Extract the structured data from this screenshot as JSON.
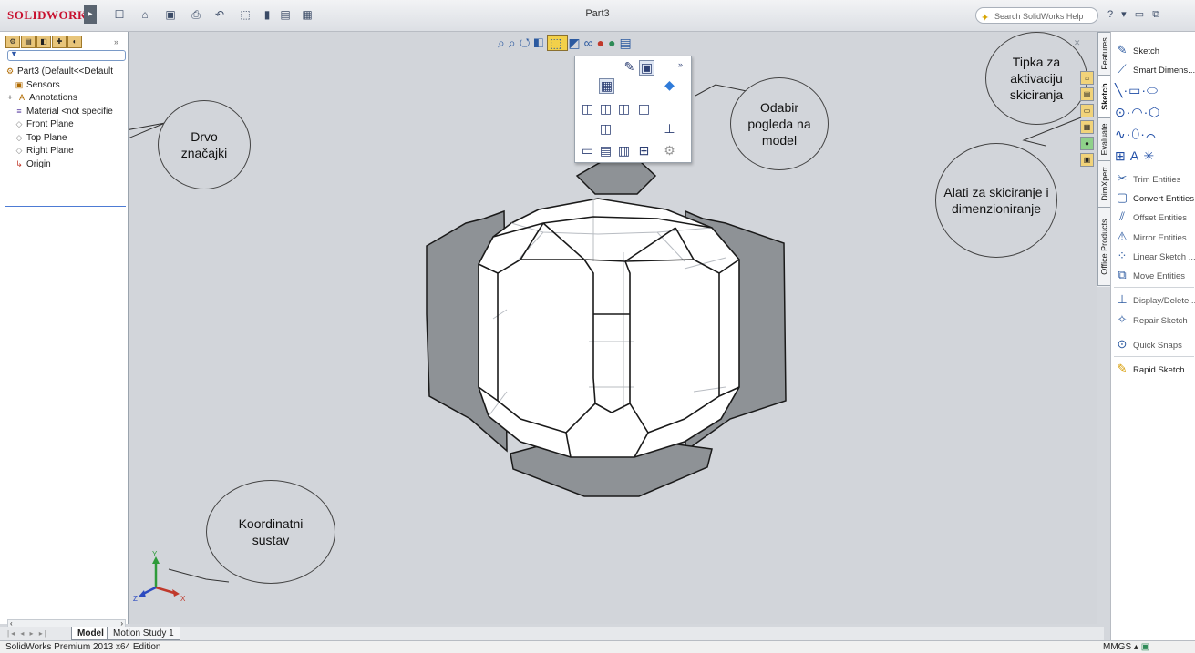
{
  "app": {
    "logo": "SOLIDWORKS",
    "document_title": "Part3",
    "help_search_placeholder": "Search SolidWorks Help",
    "window_controls": "? ▾ ▭ ⧉"
  },
  "feature_tree": {
    "root": "Part3  (Default<<Default",
    "items": [
      {
        "label": "Sensors",
        "icon": "sensor-icon"
      },
      {
        "label": "Annotations",
        "icon": "annotations-icon"
      },
      {
        "label": "Material <not specifie",
        "icon": "material-icon"
      },
      {
        "label": "Front Plane",
        "icon": "plane-icon"
      },
      {
        "label": "Top Plane",
        "icon": "plane-icon"
      },
      {
        "label": "Right Plane",
        "icon": "plane-icon"
      },
      {
        "label": "Origin",
        "icon": "origin-icon"
      }
    ]
  },
  "callouts": {
    "feature_tree": "Drvo značajki",
    "view_selection": "Odabir pogleda na model",
    "sketch_button": "Tipka za aktivaciju skiciranja",
    "sketch_tools": "Alati za skiciranje i dimenzioniranje",
    "coordinate_system": "Koordinatni sustav"
  },
  "command_tabs": [
    "Features",
    "Sketch",
    "Evaluate",
    "DimXpert",
    "Office Products"
  ],
  "commands": {
    "sketch": "Sketch",
    "smart_dimension": "Smart Dimens...",
    "trim": "Trim Entities",
    "convert": "Convert Entities",
    "offset": "Offset Entities",
    "mirror": "Mirror Entities",
    "linear": "Linear Sketch ...",
    "move": "Move Entities",
    "display_delete": "Display/Delete...",
    "repair": "Repair Sketch",
    "quick_snaps": "Quick Snaps",
    "rapid_sketch": "Rapid Sketch"
  },
  "triad": {
    "x": "X",
    "y": "Y",
    "z": "Z"
  },
  "bottom_tabs": [
    "Model",
    "Motion Study 1"
  ],
  "status": {
    "edition": "SolidWorks Premium 2013 x64 Edition",
    "units": "MMGS"
  },
  "colors": {
    "viewport_bg": "#d2d5da",
    "panel_face": "#8e9296",
    "model_edge": "#1a1a1a",
    "accent": "#2c5aa0"
  }
}
